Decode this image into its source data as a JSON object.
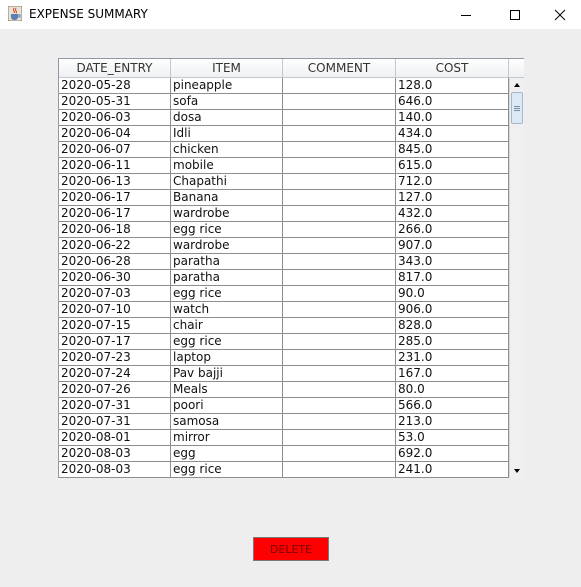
{
  "window": {
    "title": "EXPENSE SUMMARY",
    "app_icon": "java-cup-icon",
    "controls": [
      "minimize-icon",
      "maximize-icon",
      "close-icon"
    ]
  },
  "table": {
    "columns": [
      "DATE_ENTRY",
      "ITEM",
      "COMMENT",
      "COST"
    ],
    "rows": [
      [
        "2020-05-28",
        "pineapple",
        "",
        "128.0"
      ],
      [
        "2020-05-31",
        "sofa",
        "",
        "646.0"
      ],
      [
        "2020-06-03",
        "dosa",
        "",
        "140.0"
      ],
      [
        "2020-06-04",
        "Idli",
        "",
        "434.0"
      ],
      [
        "2020-06-07",
        "chicken",
        "",
        "845.0"
      ],
      [
        "2020-06-11",
        "mobile",
        "",
        "615.0"
      ],
      [
        "2020-06-13",
        "Chapathi",
        "",
        "712.0"
      ],
      [
        "2020-06-17",
        "Banana",
        "",
        "127.0"
      ],
      [
        "2020-06-17",
        "wardrobe",
        "",
        "432.0"
      ],
      [
        "2020-06-18",
        "egg rice",
        "",
        "266.0"
      ],
      [
        "2020-06-22",
        "wardrobe",
        "",
        "907.0"
      ],
      [
        "2020-06-28",
        "paratha",
        "",
        "343.0"
      ],
      [
        "2020-06-30",
        "paratha",
        "",
        "817.0"
      ],
      [
        "2020-07-03",
        "egg rice",
        "",
        "90.0"
      ],
      [
        "2020-07-10",
        "watch",
        "",
        "906.0"
      ],
      [
        "2020-07-15",
        "chair",
        "",
        "828.0"
      ],
      [
        "2020-07-17",
        "egg rice",
        "",
        "285.0"
      ],
      [
        "2020-07-23",
        "laptop",
        "",
        "231.0"
      ],
      [
        "2020-07-24",
        "Pav bajji",
        "",
        "167.0"
      ],
      [
        "2020-07-26",
        "Meals",
        "",
        "80.0"
      ],
      [
        "2020-07-31",
        "poori",
        "",
        "566.0"
      ],
      [
        "2020-07-31",
        "samosa",
        "",
        "213.0"
      ],
      [
        "2020-08-01",
        "mirror",
        "",
        "53.0"
      ],
      [
        "2020-08-03",
        "egg",
        "",
        "692.0"
      ],
      [
        "2020-08-03",
        "egg rice",
        "",
        "241.0"
      ]
    ]
  },
  "actions": {
    "delete_label": "DELETE"
  },
  "colors": {
    "delete_bg": "#ff0000",
    "window_bg": "#eeeeee"
  }
}
